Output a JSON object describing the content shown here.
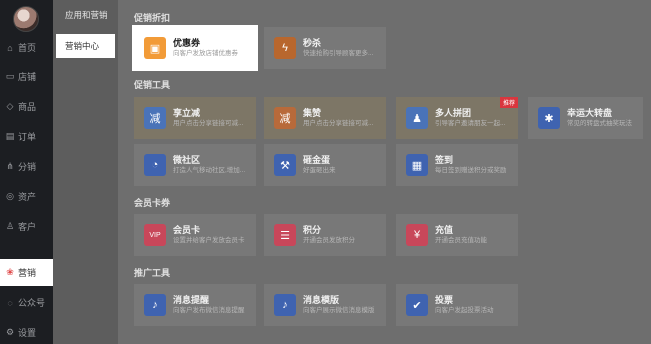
{
  "nav": {
    "items": [
      {
        "label": "首页",
        "icon": "home-icon",
        "glyph": "⌂"
      },
      {
        "label": "店铺",
        "icon": "store-icon",
        "glyph": "▭"
      },
      {
        "label": "商品",
        "icon": "goods-icon",
        "glyph": "◇"
      },
      {
        "label": "订单",
        "icon": "order-icon",
        "glyph": "▤"
      },
      {
        "label": "分销",
        "icon": "share-icon",
        "glyph": "⋔"
      },
      {
        "label": "资产",
        "icon": "asset-icon",
        "glyph": "◎"
      },
      {
        "label": "客户",
        "icon": "customer-icon",
        "glyph": "♙"
      },
      {
        "label": "营销",
        "icon": "marketing-icon",
        "glyph": "❀"
      },
      {
        "label": "公众号",
        "icon": "wechat-icon",
        "glyph": "◌"
      },
      {
        "label": "设置",
        "icon": "settings-icon",
        "glyph": "⚙"
      }
    ]
  },
  "subnav": {
    "title": "应用和营销",
    "item": "营销中心"
  },
  "sections": {
    "promo": "促销折扣",
    "tools": "促销工具",
    "member": "会员卡券",
    "push": "推广工具"
  },
  "cards": {
    "coupon": {
      "name": "优惠券",
      "desc": "向客户发放店铺优惠券",
      "icon": "coupon-icon",
      "glyph": "▣",
      "color": "#f29b38"
    },
    "seckill": {
      "name": "秒杀",
      "desc": "快速抢购引导顾客更多...",
      "icon": "lightning-icon",
      "glyph": "ϟ",
      "color": "#b8672e"
    },
    "xiangli": {
      "name": "享立减",
      "desc": "用户点击分享链接可减...",
      "icon": "discount-icon",
      "glyph": "减",
      "color": "#4a73b8"
    },
    "jizan": {
      "name": "集赞",
      "desc": "用户点击分享链接可减...",
      "icon": "discount-icon",
      "glyph": "减",
      "color": "#b86a3a"
    },
    "pintuan": {
      "name": "多人拼团",
      "desc": "引导客户邀请朋友一起...",
      "icon": "group-icon",
      "glyph": "♟",
      "color": "#4a73b8",
      "badge": "推荐"
    },
    "wheel": {
      "name": "幸运大转盘",
      "desc": "常见的转盘式抽奖玩法",
      "icon": "wheel-icon",
      "glyph": "✱",
      "color": "#3f63b0"
    },
    "community": {
      "name": "微社区",
      "desc": "打造人气移动社区,增加...",
      "icon": "chat-icon",
      "glyph": "◔",
      "color": "#3f63b0"
    },
    "egg": {
      "name": "砸金蛋",
      "desc": "好蛋砸出来",
      "icon": "hammer-icon",
      "glyph": "⚒",
      "color": "#3f63b0"
    },
    "signin": {
      "name": "签到",
      "desc": "每日签到赠送积分或奖励",
      "icon": "calendar-icon",
      "glyph": "▦",
      "color": "#3f63b0"
    },
    "vipcard": {
      "name": "会员卡",
      "desc": "设置并给客户发放会员卡",
      "icon": "vip-card-icon",
      "glyph": "VIP",
      "color": "#c8475a"
    },
    "points": {
      "name": "积分",
      "desc": "开通会员发放积分",
      "icon": "database-icon",
      "glyph": "☰",
      "color": "#c8475a"
    },
    "recharge": {
      "name": "充值",
      "desc": "开通会员充值功能",
      "icon": "wallet-icon",
      "glyph": "¥",
      "color": "#c8475a"
    },
    "msgremind": {
      "name": "消息提醒",
      "desc": "向客户发布微信消息提醒",
      "icon": "bell-icon",
      "glyph": "♪",
      "color": "#3f63b0"
    },
    "msgtpl": {
      "name": "消息模版",
      "desc": "向客户展示微信消息模版",
      "icon": "bell-icon",
      "glyph": "♪",
      "color": "#3f63b0"
    },
    "vote": {
      "name": "投票",
      "desc": "向客户发起投票活动",
      "icon": "vote-icon",
      "glyph": "✔",
      "color": "#3f63b0"
    }
  },
  "colors": {
    "nav_bg": "#1c1e22",
    "overlay": "#6e6e6e",
    "active_accent": "#e04b4b"
  }
}
